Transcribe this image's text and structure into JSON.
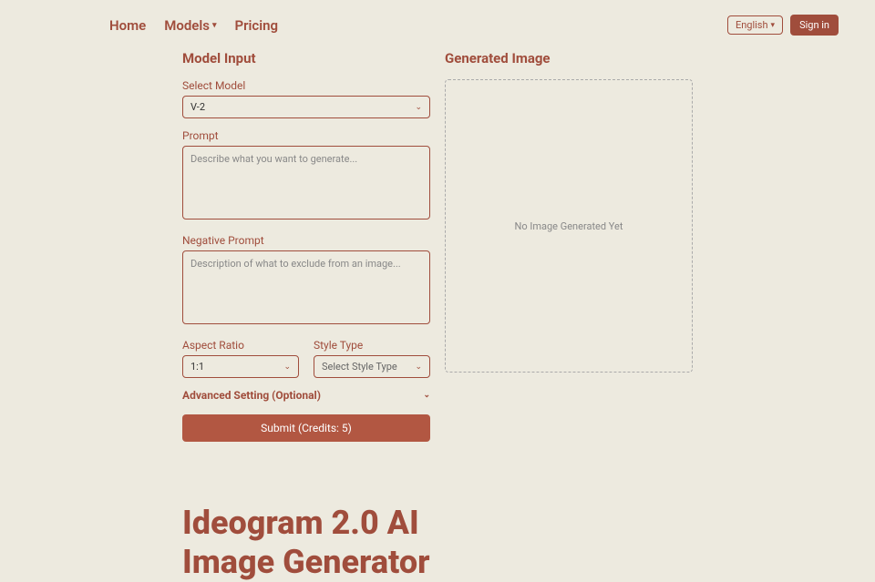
{
  "nav": {
    "home": "Home",
    "models": "Models",
    "pricing": "Pricing"
  },
  "header": {
    "language": "English",
    "signin": "Sign in"
  },
  "left": {
    "title": "Model Input",
    "model_label": "Select Model",
    "model_value": "V-2",
    "prompt_label": "Prompt",
    "prompt_placeholder": "Describe what you want to generate...",
    "negative_label": "Negative Prompt",
    "negative_placeholder": "Description of what to exclude from an image...",
    "aspect_label": "Aspect Ratio",
    "aspect_value": "1:1",
    "style_label": "Style Type",
    "style_placeholder": "Select Style Type",
    "advanced": "Advanced Setting (Optional)",
    "submit": "Submit (Credits: 5)"
  },
  "right": {
    "title": "Generated Image",
    "empty": "No Image Generated Yet"
  },
  "hero": {
    "title": "Ideogram 2.0 AI Image Generator"
  }
}
